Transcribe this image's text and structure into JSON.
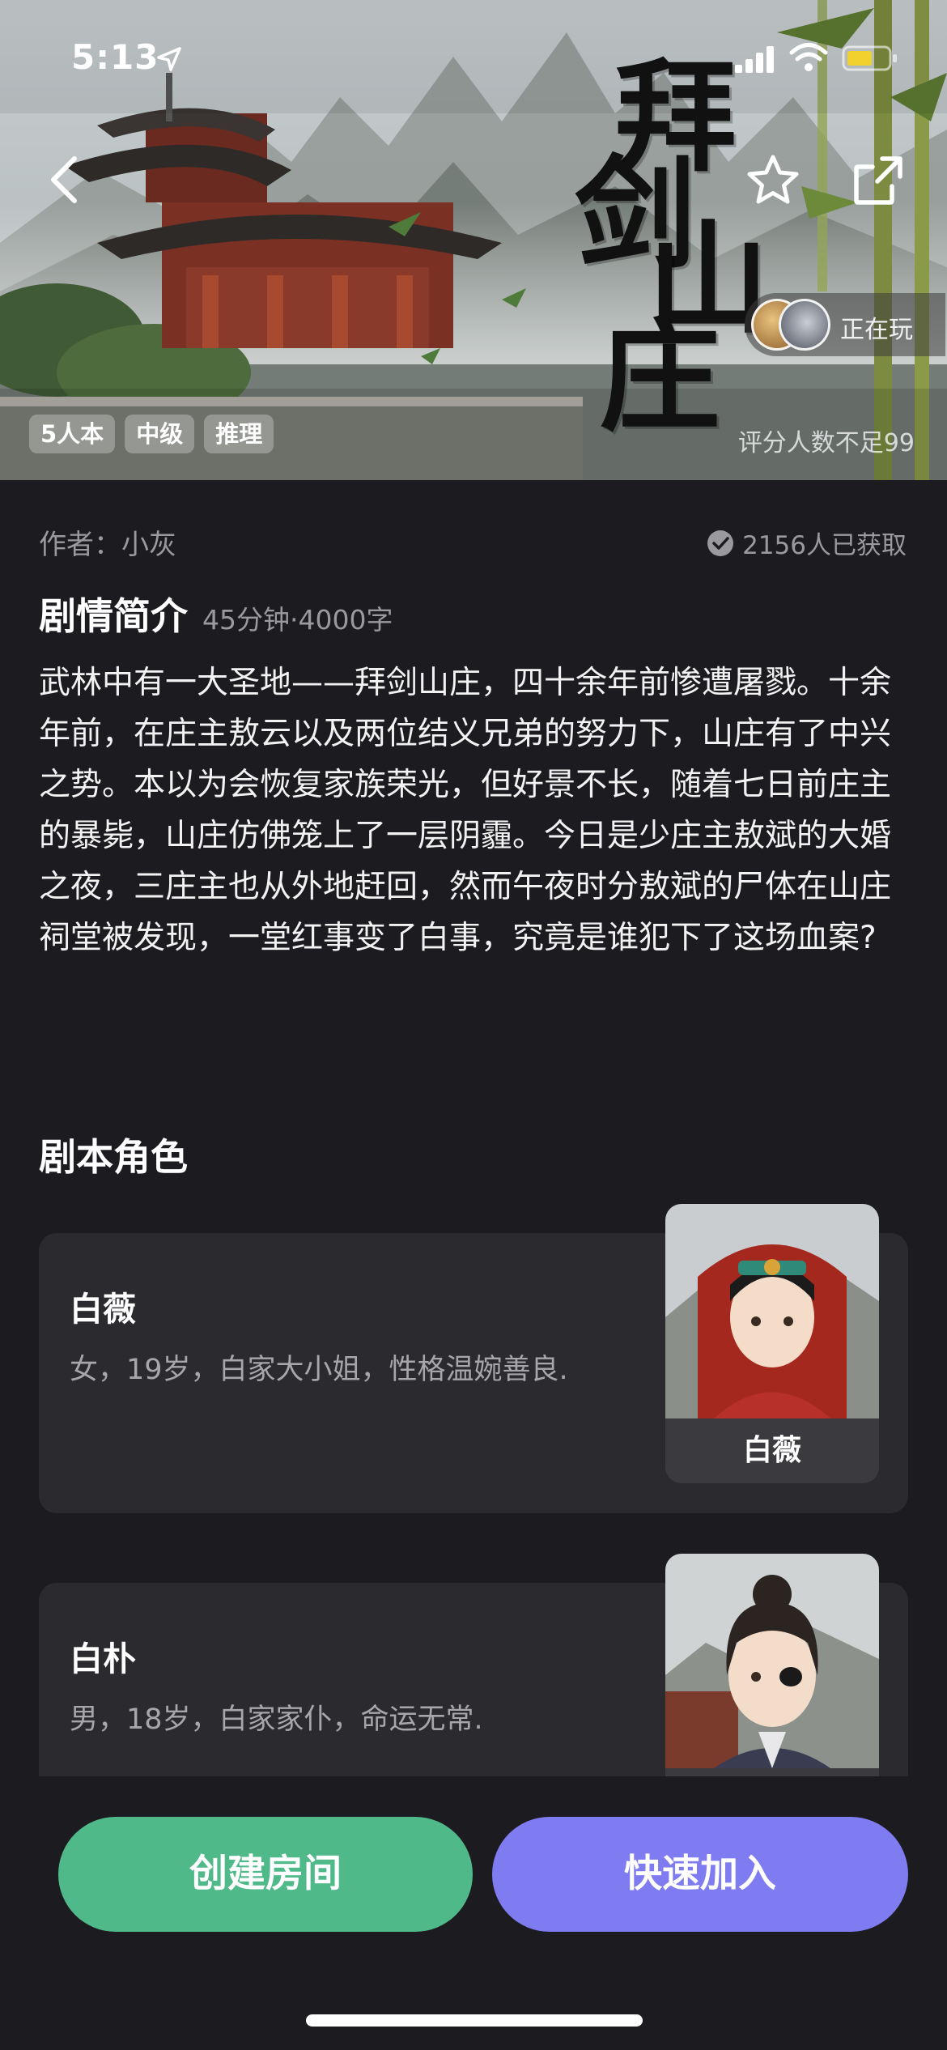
{
  "status_bar": {
    "time": "5:13",
    "icons": [
      "location-arrow-icon",
      "signal-icon",
      "wifi-icon",
      "battery-icon"
    ]
  },
  "hero": {
    "title_calligraphy": [
      "拜",
      "剑",
      "山",
      "庄"
    ],
    "playing_label": "正在玩",
    "tags": [
      "5人本",
      "中级",
      "推理"
    ],
    "rating_note": "评分人数不足99",
    "icons": {
      "back": "chevron-left-icon",
      "favorite": "star-icon",
      "share": "share-icon"
    }
  },
  "info": {
    "author": "作者：小灰",
    "obtained": "2156人已获取",
    "synopsis_title": "剧情简介",
    "synopsis_meta": "45分钟·4000字",
    "synopsis": "武林中有一大圣地——拜剑山庄，四十余年前惨遭屠戮。十余年前，在庄主敖云以及两位结义兄弟的努力下，山庄有了中兴之势。本以为会恢复家族荣光，但好景不长，随着七日前庄主的暴毙，山庄仿佛笼上了一层阴霾。今日是少庄主敖斌的大婚之夜，三庄主也从外地赶回，然而午夜时分敖斌的尸体在山庄祠堂被发现，一堂红事变了白事，究竟是谁犯下了这场血案?"
  },
  "roles": {
    "title": "剧本角色",
    "items": [
      {
        "name": "白薇",
        "description": "女，19岁，白家大小姐，性格温婉善良.",
        "portrait_label": "白薇"
      },
      {
        "name": "白朴",
        "description": "男，18岁，白家家仆，命运无常."
      }
    ]
  },
  "actions": {
    "create_room": "创建房间",
    "quick_join": "快速加入"
  },
  "colors": {
    "background": "#1c1b1f",
    "card": "#2b2a2e",
    "create_button": "#4fb98a",
    "join_button": "#7f7bf0",
    "muted_text": "#9a9a9e"
  }
}
